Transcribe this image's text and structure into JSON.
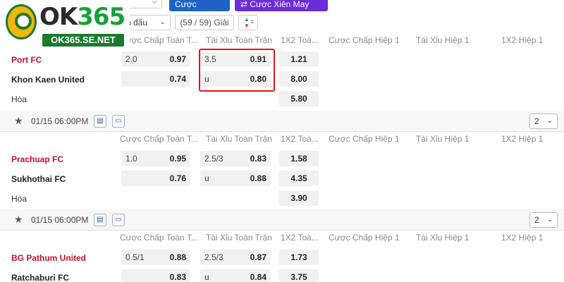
{
  "brand": {
    "logo_text_ok": "OK",
    "logo_text_num": "365",
    "site": "OK365.SE.NET"
  },
  "toolbar": {
    "parlay_label": "Cược Xiên",
    "lucky_parlay_label": "Cược Xiên May Mắn",
    "filter_label": "n đấu",
    "count_label": "(59 / 59) Giải"
  },
  "columns": [
    "Cược Chấp Toàn T...",
    "Tài Xỉu Toàn Trận",
    "1X2 Toà...",
    "Cược Chấp Hiệp 1",
    "Tài Xỉu Hiệp 1",
    "1X2 Hiệp 1"
  ],
  "first_header": [
    "Cược Chấp Toàn T...",
    "Tài Xỉu Toàn Trận",
    "1X2 Toà...",
    "Cược Chấp Hiệp 1",
    "Tài Xỉu Hiệp 1",
    "1X2 Hiệp 1"
  ],
  "draw_label": "Hòa",
  "matches": [
    {
      "home": "Port FC",
      "away": "Khon Kaen United",
      "hdp_line": "2.0",
      "hdp_home": "0.97",
      "hdp_away": "0.74",
      "ou_line": "3.5",
      "ou_over": "0.91",
      "ou_under_label": "u",
      "ou_under": "0.80",
      "x12_home": "1.21",
      "x12_away": "8.00",
      "x12_draw": "5.80",
      "time": "01/15 06:00PM",
      "more": "2"
    },
    {
      "home": "Prachuap FC",
      "away": "Sukhothai FC",
      "hdp_line": "1.0",
      "hdp_home": "0.95",
      "hdp_away": "0.76",
      "ou_line": "2.5/3",
      "ou_over": "0.83",
      "ou_under_label": "u",
      "ou_under": "0.88",
      "x12_home": "1.58",
      "x12_away": "4.35",
      "x12_draw": "3.90",
      "time": "01/15 06:00PM",
      "more": "2"
    },
    {
      "home": "BG Pathum United",
      "away": "Ratchaburi FC",
      "hdp_line": "0.5/1",
      "hdp_home": "0.88",
      "hdp_away": "0.83",
      "ou_line": "2.5/3",
      "ou_over": "0.87",
      "ou_under_label": "u",
      "ou_under": "0.84",
      "x12_home": "1.73",
      "x12_away": "3.75"
    }
  ]
}
